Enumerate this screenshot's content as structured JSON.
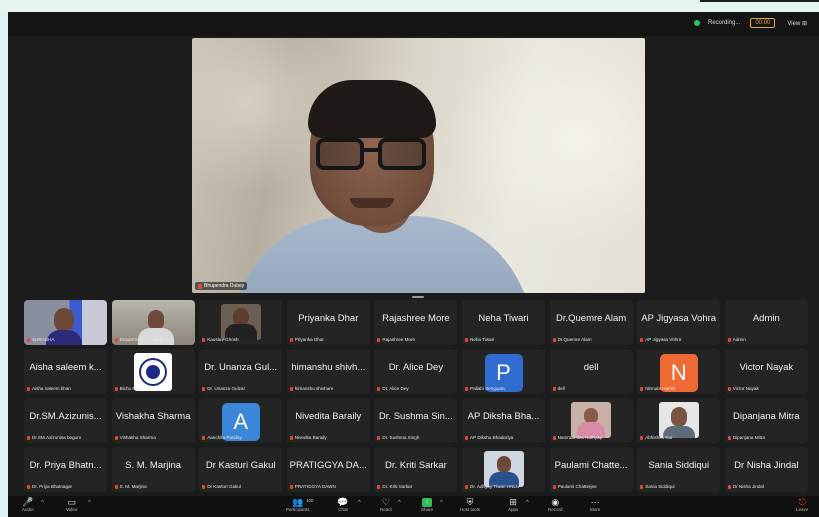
{
  "recording": {
    "label": "Recording...",
    "timer": "00:00",
    "view_label": "View"
  },
  "speaker": {
    "name": "Bhupendra Dubey"
  },
  "participants": [
    {
      "name": "",
      "label": "SHRADHA",
      "style": "photo",
      "photo": "woman"
    },
    {
      "name": "",
      "label": "Department of Law (S.T)...",
      "style": "photo",
      "photo": "man-office"
    },
    {
      "name": "",
      "label": "Kaustav Ghosh",
      "style": "photo",
      "photo": "man-suit"
    },
    {
      "name": "Priyanka Dhar",
      "label": "Priyanka Dhar",
      "style": "name"
    },
    {
      "name": "Rajashree More",
      "label": "Rajashree More",
      "style": "name"
    },
    {
      "name": "Neha Tiwari",
      "label": "Neha Tiwari",
      "style": "name"
    },
    {
      "name": "Dr.Quemre Alam",
      "label": "Dr.Quemre Alam",
      "style": "name"
    },
    {
      "name": "AP Jigyasa Vohra",
      "label": "AP Jigyasa Vohra",
      "style": "name"
    },
    {
      "name": "Admin",
      "label": "Admin",
      "style": "name"
    },
    {
      "name": "Aisha saleem k...",
      "label": "Aisha saleem khan",
      "style": "name"
    },
    {
      "name": "",
      "label": "Bichu Milan",
      "style": "photo",
      "photo": "logo"
    },
    {
      "name": "Dr. Unanza Gul...",
      "label": "Dr. Unanza Gulzar",
      "style": "name"
    },
    {
      "name": "himanshu shivh...",
      "label": "himanshu shivhare",
      "style": "name"
    },
    {
      "name": "Dr. Alice Dey",
      "label": "Dr. Alice Dey",
      "style": "name"
    },
    {
      "name": "",
      "label": "Pallabi Sengupta",
      "style": "avatar",
      "letter": "P",
      "color": "#2f6bd0"
    },
    {
      "name": "dell",
      "label": "dell",
      "style": "name"
    },
    {
      "name": "",
      "label": "Nirmala Harish",
      "style": "avatar",
      "letter": "N",
      "color": "#f06a35"
    },
    {
      "name": "Victor Nayak",
      "label": "Victor Nayak",
      "style": "name"
    },
    {
      "name": "Dr.SM.Azizunis...",
      "label": "Dr.SM.Azizunisa begum",
      "style": "name"
    },
    {
      "name": "Vishakha Sharma",
      "label": "Vishakha Sharma",
      "style": "name"
    },
    {
      "name": "",
      "label": "Aanchita Pandey",
      "style": "avatar",
      "letter": "A",
      "color": "#3a86d8"
    },
    {
      "name": "Nivedita Baraily",
      "label": "Nivedita Baraily",
      "style": "name"
    },
    {
      "name": "Dr. Sushma Sin...",
      "label": "Dr. Sushma Singh",
      "style": "name"
    },
    {
      "name": "AP Diksha Bha...",
      "label": "AP Diksha Bhadoriya",
      "style": "name"
    },
    {
      "name": "",
      "label": "Namrata das Nathyap",
      "style": "photo",
      "photo": "woman-pink"
    },
    {
      "name": "",
      "label": "Abhishek Kar",
      "style": "photo",
      "photo": "man-beard"
    },
    {
      "name": "Dipanjana Mitra",
      "label": "Dipanjana Mitra",
      "style": "name"
    },
    {
      "name": "Dr. Priya Bhatn...",
      "label": "Dr. Priya Bhatnagar",
      "style": "name"
    },
    {
      "name": "S. M. Marjina",
      "label": "S. M. Marjina",
      "style": "name"
    },
    {
      "name": "Dr Kasturi Gakul",
      "label": "Dr Kasturi Gakul",
      "style": "name"
    },
    {
      "name": "PRATIGGYA DA...",
      "label": "PRATIGGYA DAWN",
      "style": "name"
    },
    {
      "name": "Dr. Kriti Sarkar",
      "label": "Dr. Kriti Sarkar",
      "style": "name"
    },
    {
      "name": "",
      "label": "Dr. Adhyay Tiwari HNLU",
      "style": "photo",
      "photo": "man-blue"
    },
    {
      "name": "Paulami Chatte...",
      "label": "Paulami Chatterjee",
      "style": "name"
    },
    {
      "name": "Sania Siddiqui",
      "label": "Sania Siddiqui",
      "style": "name"
    },
    {
      "name": "Dr Nisha Jindal",
      "label": "Dr Nisha Jindal",
      "style": "name"
    }
  ],
  "toolbar": {
    "audio": "Audio",
    "video": "Video",
    "participants": "Participants",
    "participants_count": "100",
    "chat": "Chat",
    "react": "React",
    "share": "Share",
    "host_tools": "Host tools",
    "apps": "Apps",
    "record": "Record",
    "more": "More",
    "leave": "Leave"
  }
}
